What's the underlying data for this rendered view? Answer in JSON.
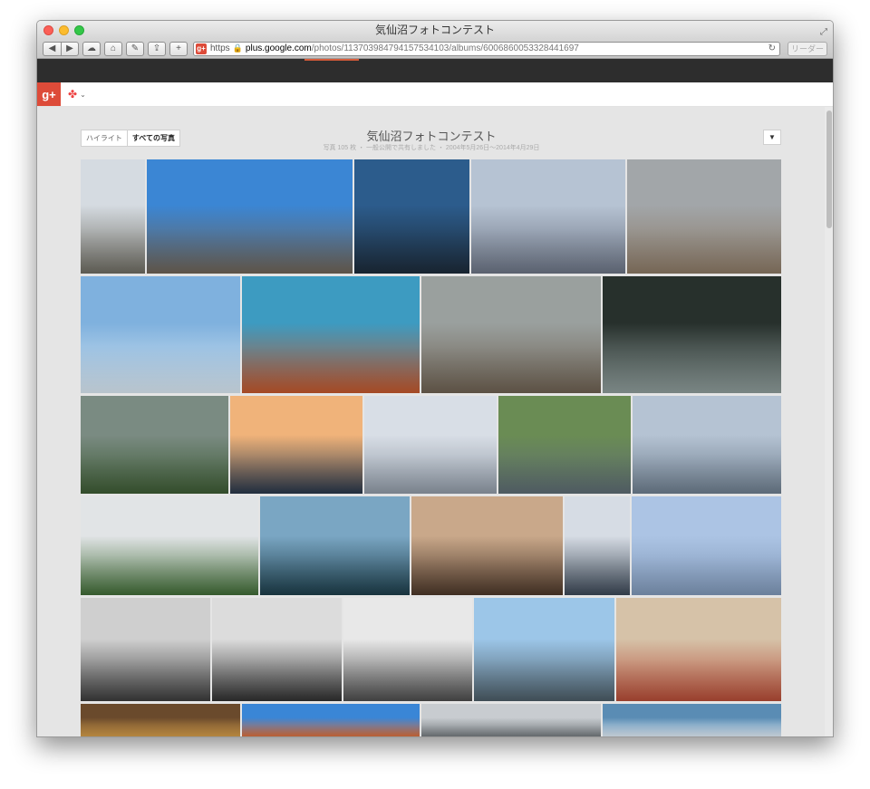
{
  "window": {
    "title": "気仙沼フォトコンテスト",
    "url": {
      "scheme": "https",
      "host": "plus.google.com",
      "path": "/photos/113703984794157534103/albums/6006860053328441697"
    },
    "reader_label": "リーダー"
  },
  "gplus": {
    "logo": "g+"
  },
  "album": {
    "tabs": [
      {
        "label": "ハイライト",
        "active": false
      },
      {
        "label": "すべての写真",
        "active": true
      }
    ],
    "title": "気仙沼フォトコンテスト",
    "meta": "写真 105 枚 ・ 一般公開で共有しました ・ 2004年5月26日〜2014年4月29日"
  },
  "photos": [
    {
      "subject": "rocky-hillside",
      "colors": [
        "#d5dbe1",
        "#6c6a60"
      ]
    },
    {
      "subject": "rocky-coast-blue-sky",
      "colors": [
        "#3b86d4",
        "#6e6254"
      ]
    },
    {
      "subject": "sunlit-sea-rocks",
      "colors": [
        "#2c5c8c",
        "#1c2a38"
      ]
    },
    {
      "subject": "fishing-boat-harbor-dusk",
      "colors": [
        "#b6c3d3",
        "#6a7282"
      ]
    },
    {
      "subject": "beach-two-people",
      "colors": [
        "#a2a6a9",
        "#8a7864"
      ]
    },
    {
      "subject": "ship-masts-sky",
      "colors": [
        "#7fb1de",
        "#d8e6f0"
      ]
    },
    {
      "subject": "crabs-in-blue-crates",
      "colors": [
        "#3d9bc1",
        "#c2562b"
      ]
    },
    {
      "subject": "fishermen-on-pier",
      "colors": [
        "#9aa09e",
        "#6c5f50"
      ]
    },
    {
      "subject": "tuna-on-ice",
      "colors": [
        "#27302c",
        "#8e9c9a"
      ]
    },
    {
      "subject": "river-reeds",
      "colors": [
        "#7a8b82",
        "#3c5a33"
      ]
    },
    {
      "subject": "harbor-sunset",
      "colors": [
        "#f0b37a",
        "#27364a"
      ]
    },
    {
      "subject": "tetrapods",
      "colors": [
        "#d8dee6",
        "#8e98a4"
      ]
    },
    {
      "subject": "tide-pool-person",
      "colors": [
        "#6a8c54",
        "#5c6a72"
      ]
    },
    {
      "subject": "calm-sea-jetty",
      "colors": [
        "#b5c3d3",
        "#6c7c8c"
      ]
    },
    {
      "subject": "misty-islands",
      "colors": [
        "#e1e4e6",
        "#3f6a35"
      ]
    },
    {
      "subject": "sea-sunset-clouds",
      "colors": [
        "#7aa6c3",
        "#1c3c48"
      ]
    },
    {
      "subject": "festival-crowd",
      "colors": [
        "#c9a88a",
        "#4a3628"
      ]
    },
    {
      "subject": "girl-feeding-gulls",
      "colors": [
        "#d6dce4",
        "#3a4654"
      ]
    },
    {
      "subject": "seagulls-flying",
      "colors": [
        "#acc4e4",
        "#7e96b6"
      ]
    },
    {
      "subject": "bw-nets-drying",
      "colors": [
        "#cfcfcf",
        "#3a3a3a"
      ]
    },
    {
      "subject": "bw-town-view",
      "colors": [
        "#dcdcdc",
        "#2e2e2e"
      ]
    },
    {
      "subject": "bw-factory-water",
      "colors": [
        "#e8e8e8",
        "#4a4a4a"
      ]
    },
    {
      "subject": "people-on-rocks-sea",
      "colors": [
        "#9cc6e8",
        "#4a5a64"
      ]
    },
    {
      "subject": "grilled-scallops",
      "colors": [
        "#d6c2a8",
        "#b34a35"
      ]
    },
    {
      "subject": "grilled-seafood",
      "colors": [
        "#6a4a2c",
        "#d8a04a"
      ]
    },
    {
      "subject": "blue-gloves-orange",
      "colors": [
        "#3a86d6",
        "#e56a2b"
      ]
    },
    {
      "subject": "sea-creature-display",
      "colors": [
        "#c8ccd0",
        "#6a7074"
      ]
    },
    {
      "subject": "bottle-on-blue",
      "colors": [
        "#5a8cb4",
        "#e6eef4"
      ]
    }
  ]
}
